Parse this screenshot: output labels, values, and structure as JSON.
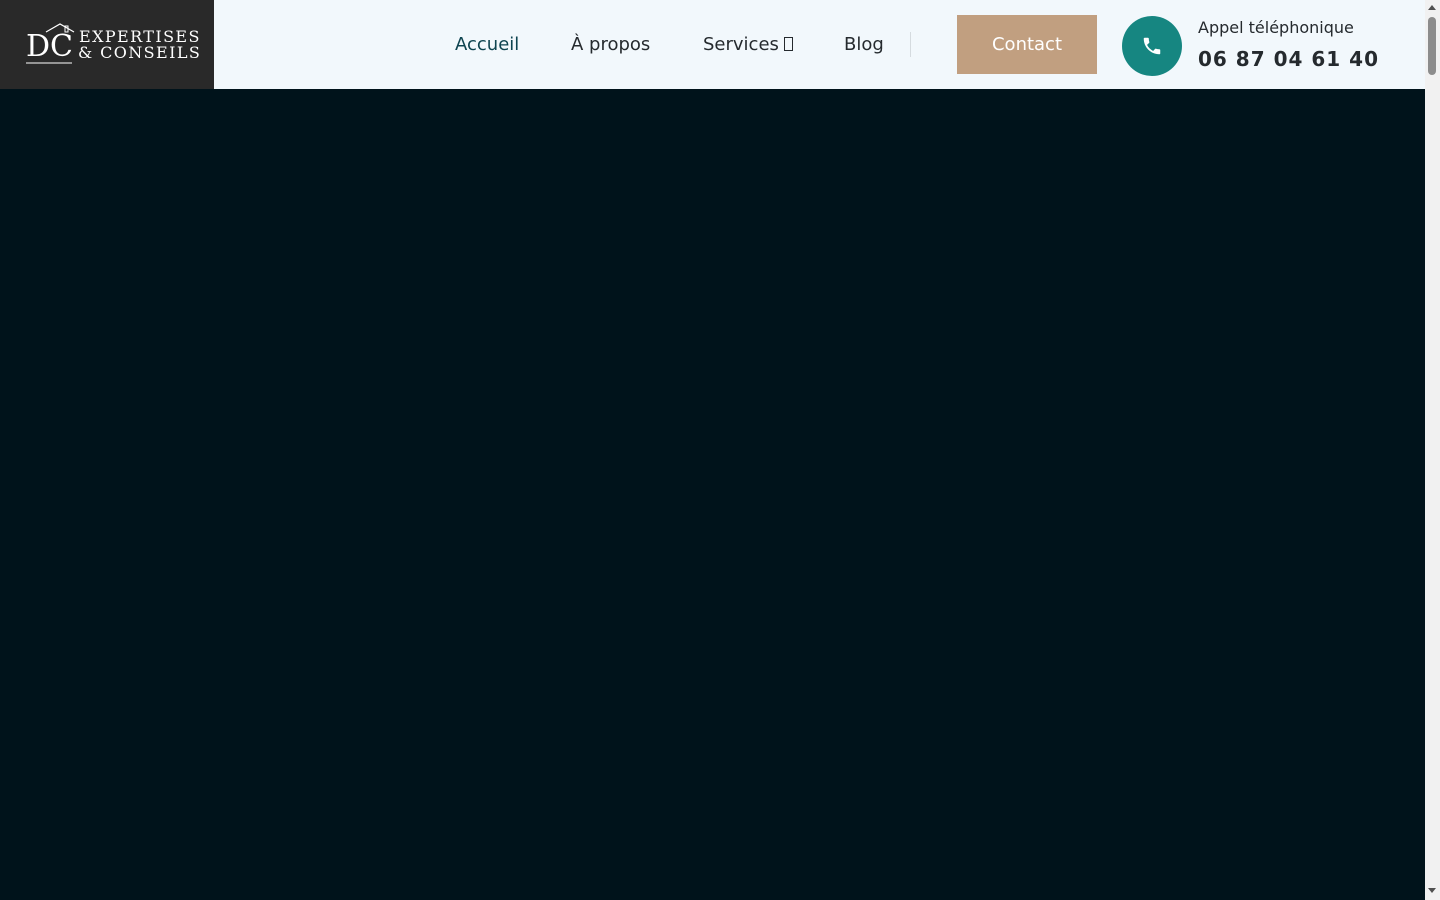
{
  "logo": {
    "monogram": "DC",
    "line1": "EXPERTISES",
    "line2": "& CONSEILS"
  },
  "nav": {
    "items": [
      {
        "label": "Accueil",
        "active": true
      },
      {
        "label": "À propos"
      },
      {
        "label": "Services"
      },
      {
        "label": "Blog"
      }
    ]
  },
  "header": {
    "contact_label": "Contact",
    "phone_label": "Appel téléphonique",
    "phone_number": "06 87 04 61 40"
  },
  "icons": {
    "logo": "house-monogram-icon",
    "services_caret": "dropdown-icon",
    "phone": "phone-icon"
  },
  "colors": {
    "hero_bg": "#00131b",
    "header_bg": "#f2f8fc",
    "logo_bg": "#292929",
    "contact_bg": "#c19f80",
    "phone_circle": "#168681",
    "active_nav": "#0e4450"
  }
}
